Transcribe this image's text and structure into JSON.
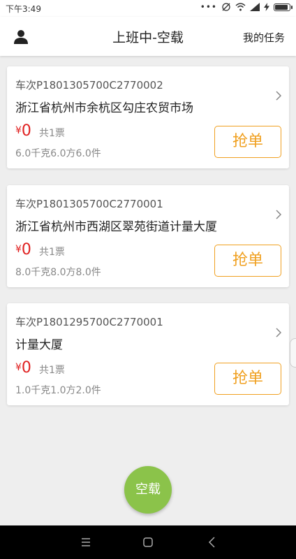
{
  "status_bar": {
    "time": "下午3:49",
    "dots": "•••",
    "battery_level": 0.9
  },
  "header": {
    "title": "上班中-空载",
    "right_action": "我的任务",
    "left_icon": "user-icon"
  },
  "orders": [
    {
      "trip": "车次P1801305700C2770002",
      "address": "浙江省杭州市余杭区勾庄农贸市场",
      "currency": "¥",
      "price": "0",
      "count": "共1票",
      "spec": "6.0千克6.0方6.0件",
      "action": "抢单"
    },
    {
      "trip": "车次P1801305700C2770001",
      "address": "浙江省杭州市西湖区翠苑街道计量大厦",
      "currency": "¥",
      "price": "0",
      "count": "共1票",
      "spec": "8.0千克8.0方8.0件",
      "action": "抢单"
    },
    {
      "trip": "车次P1801295700C2770001",
      "address": "计量大厦",
      "currency": "¥",
      "price": "0",
      "count": "共1票",
      "spec": "1.0千克1.0方2.0件",
      "action": "抢单"
    }
  ],
  "fab": {
    "label": "空载"
  },
  "colors": {
    "accent_orange": "#f0a020",
    "price_red": "#e02020",
    "fab_green": "#8bc34a"
  }
}
